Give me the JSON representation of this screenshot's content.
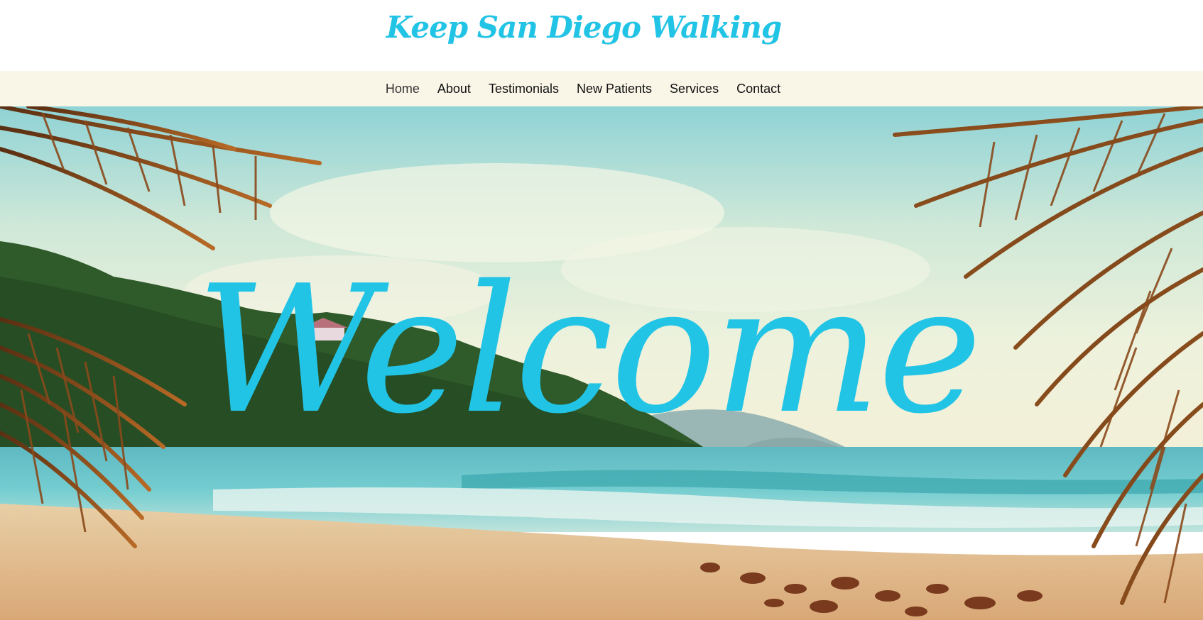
{
  "site": {
    "title": "Keep San Diego Walking",
    "brand_color": "#22c4e6"
  },
  "nav": {
    "items": [
      {
        "label": "Home",
        "active": true
      },
      {
        "label": "About"
      },
      {
        "label": "Testimonials"
      },
      {
        "label": "New Patients"
      },
      {
        "label": "Services"
      },
      {
        "label": "Contact"
      }
    ],
    "background": "#f9f6e8"
  },
  "hero": {
    "heading": "Welcome",
    "image": "tropical-beach-with-palm-fronds"
  }
}
